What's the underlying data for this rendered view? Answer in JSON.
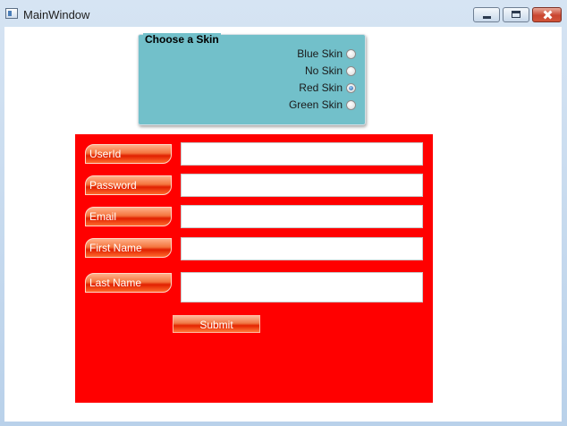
{
  "window": {
    "title": "MainWindow"
  },
  "skin_group": {
    "header": "Choose a Skin",
    "options": [
      {
        "label": "Blue Skin",
        "checked": false
      },
      {
        "label": "No Skin",
        "checked": false
      },
      {
        "label": "Red Skin",
        "checked": true
      },
      {
        "label": "Green Skin",
        "checked": false
      }
    ]
  },
  "form": {
    "panel_color": "#ff0000",
    "fields": [
      {
        "label": "UserId",
        "value": ""
      },
      {
        "label": "Password",
        "value": ""
      },
      {
        "label": "Email",
        "value": ""
      },
      {
        "label": "First Name",
        "value": ""
      },
      {
        "label": "Last Name",
        "value": ""
      }
    ],
    "submit_label": "Submit"
  }
}
